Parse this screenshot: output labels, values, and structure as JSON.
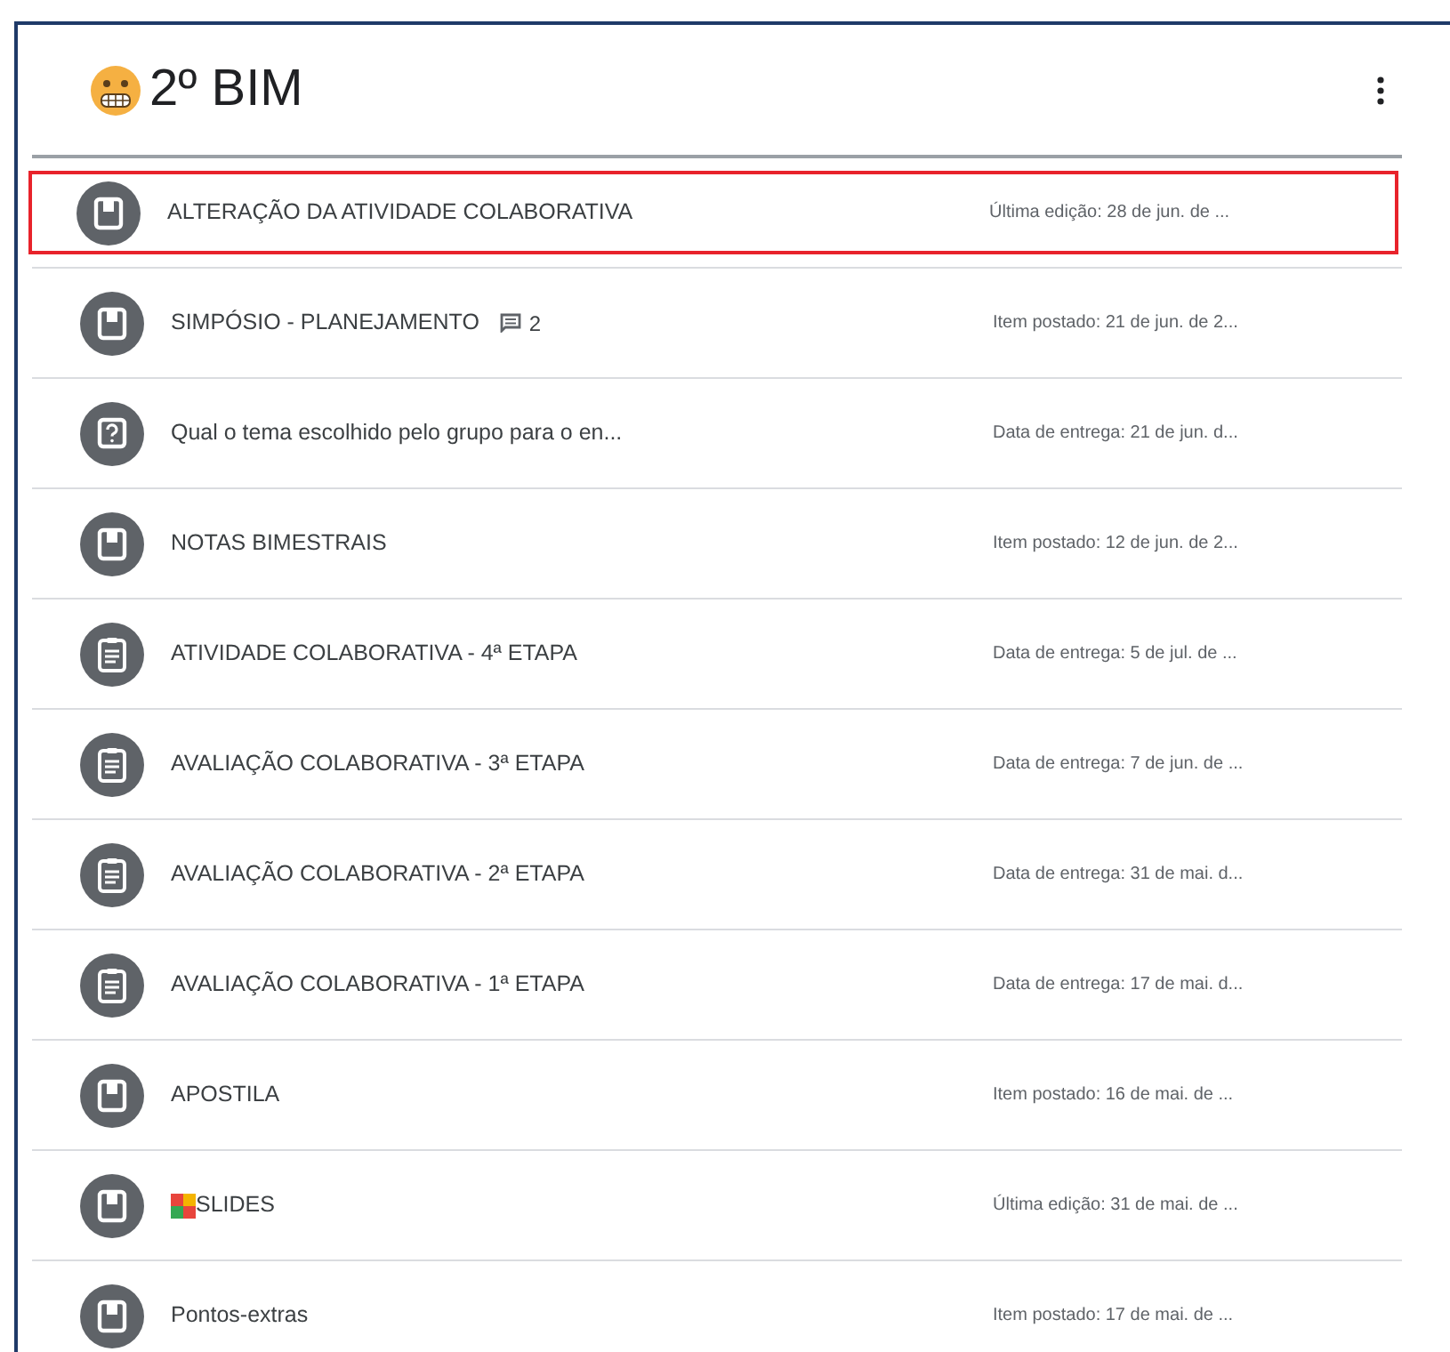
{
  "topic": {
    "title": "2º BIM"
  },
  "items": [
    {
      "kind": "material",
      "title": "ALTERAÇÃO DA ATIVIDADE COLABORATIVA",
      "date": "Última edição: 28 de jun. de ...",
      "highlighted": true
    },
    {
      "kind": "material",
      "title": "SIMPÓSIO - PLANEJAMENTO",
      "comments": "2",
      "date": "Item postado: 21 de jun. de 2...",
      "highlighted": false
    },
    {
      "kind": "question",
      "title": "Qual o tema escolhido pelo grupo para o en...",
      "date": "Data de entrega: 21 de jun. d...",
      "highlighted": false
    },
    {
      "kind": "material",
      "title": "NOTAS BIMESTRAIS",
      "date": "Item postado: 12 de jun. de 2...",
      "highlighted": false
    },
    {
      "kind": "assignment",
      "title": "ATIVIDADE COLABORATIVA - 4ª ETAPA",
      "date": "Data de entrega: 5 de jul. de ...",
      "highlighted": false
    },
    {
      "kind": "assignment",
      "title": "AVALIAÇÃO COLABORATIVA - 3ª ETAPA",
      "date": "Data de entrega: 7 de jun. de ...",
      "highlighted": false
    },
    {
      "kind": "assignment",
      "title": "AVALIAÇÃO COLABORATIVA - 2ª ETAPA",
      "date": "Data de entrega: 31 de mai. d...",
      "highlighted": false
    },
    {
      "kind": "assignment",
      "title": "AVALIAÇÃO COLABORATIVA - 1ª ETAPA",
      "date": "Data de entrega: 17 de mai. d...",
      "highlighted": false
    },
    {
      "kind": "material",
      "title": "APOSTILA",
      "date": "Item postado: 16 de mai. de ...",
      "highlighted": false
    },
    {
      "kind": "material",
      "title": "SLIDES",
      "slides_icon": true,
      "date": "Última edição: 31 de mai. de ...",
      "highlighted": false
    },
    {
      "kind": "material",
      "title": "Pontos-extras",
      "date": "Item postado: 17 de mai. de ...",
      "highlighted": false
    }
  ]
}
